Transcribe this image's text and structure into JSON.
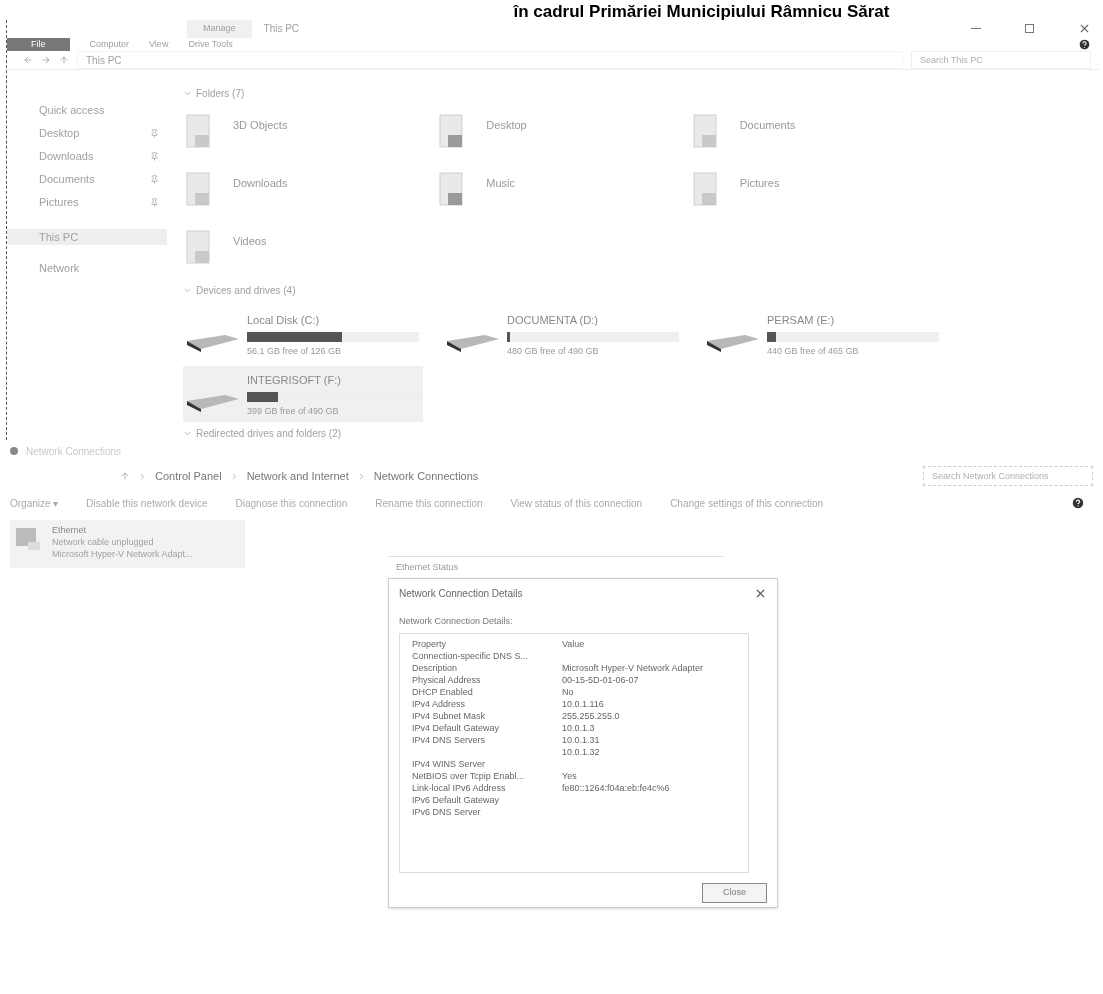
{
  "document_heading": "în cadrul Primăriei Municipiului Râmnicu Sărat",
  "explorer": {
    "title_tab": "Manage",
    "title": "This PC",
    "ribbon_tabs": [
      {
        "label": "File",
        "selected": true
      },
      {
        "label": "Computer",
        "selected": false
      },
      {
        "label": "View",
        "selected": false
      },
      {
        "label": "Drive Tools",
        "selected": false
      }
    ],
    "address": "This PC",
    "search": {
      "placeholder": "Search This PC"
    },
    "sidebar": [
      {
        "label": "Quick access",
        "selected": false,
        "pinned": false
      },
      {
        "label": "Desktop",
        "selected": false,
        "pinned": true
      },
      {
        "label": "Downloads",
        "selected": false,
        "pinned": true
      },
      {
        "label": "Documents",
        "selected": false,
        "pinned": true
      },
      {
        "label": "Pictures",
        "selected": false,
        "pinned": true
      },
      {
        "label": "This PC",
        "selected": true,
        "pinned": false
      },
      {
        "label": "Network",
        "selected": false,
        "pinned": false
      }
    ],
    "folders_heading": "Folders (7)",
    "folders": [
      {
        "name": "3D Objects"
      },
      {
        "name": "Desktop"
      },
      {
        "name": "Documents"
      },
      {
        "name": "Downloads"
      },
      {
        "name": "Music"
      },
      {
        "name": "Pictures"
      },
      {
        "name": "Videos"
      }
    ],
    "devices_heading": "Devices and drives (4)",
    "drives": [
      {
        "name": "Local Disk (C:)",
        "free": "56.1 GB free of 126 GB",
        "level": 0.55,
        "selected": false
      },
      {
        "name": "DOCUMENTA (D:)",
        "free": "480 GB free of 490 GB",
        "level": 0.02,
        "selected": false
      },
      {
        "name": "PERSAM (E:)",
        "free": "440 GB free of 465 GB",
        "level": 0.05,
        "selected": false
      },
      {
        "name": "INTEGRISOFT (F:)",
        "free": "399 GB free of 490 GB",
        "level": 0.18,
        "selected": true
      }
    ],
    "network_heading": "Redirected drives and folders (2)"
  },
  "network_window": {
    "title": "Network Connections",
    "breadcrumb": [
      "Control Panel",
      "Network and Internet",
      "Network Connections"
    ],
    "search": {
      "placeholder": "Search Network Connections"
    },
    "toolbar": [
      "Organize ▾",
      "Disable this network device",
      "Diagnose this connection",
      "Rename this connection",
      "View status of this connection",
      "Change settings of this connection"
    ],
    "adapter": {
      "name": "Ethernet",
      "status": "Network cable unplugged",
      "device": "Microsoft Hyper-V Network Adapt..."
    },
    "behind_title": "Ethernet Status"
  },
  "dialog": {
    "title": "Network Connection Details",
    "group": "Network Connection Details:",
    "columns": [
      "Property",
      "Value"
    ],
    "rows": [
      [
        "Connection-specific DNS S...",
        ""
      ],
      [
        "Description",
        "Microsoft Hyper-V Network Adapter"
      ],
      [
        "Physical Address",
        "00-15-5D-01-06-07"
      ],
      [
        "DHCP Enabled",
        "No"
      ],
      [
        "IPv4 Address",
        "10.0.1.116"
      ],
      [
        "IPv4 Subnet Mask",
        "255.255.255.0"
      ],
      [
        "IPv4 Default Gateway",
        "10.0.1.3"
      ],
      [
        "IPv4 DNS Servers",
        "10.0.1.31"
      ],
      [
        "",
        "10.0.1.32"
      ],
      [
        "IPv4 WINS Server",
        ""
      ],
      [
        "NetBIOS over Tcpip Enabl...",
        "Yes"
      ],
      [
        "Link-local IPv6 Address",
        "fe80::1264:f04a:eb:fe4c%6"
      ],
      [
        "IPv6 Default Gateway",
        ""
      ],
      [
        "IPv6 DNS Server",
        ""
      ]
    ],
    "button": "Close"
  }
}
